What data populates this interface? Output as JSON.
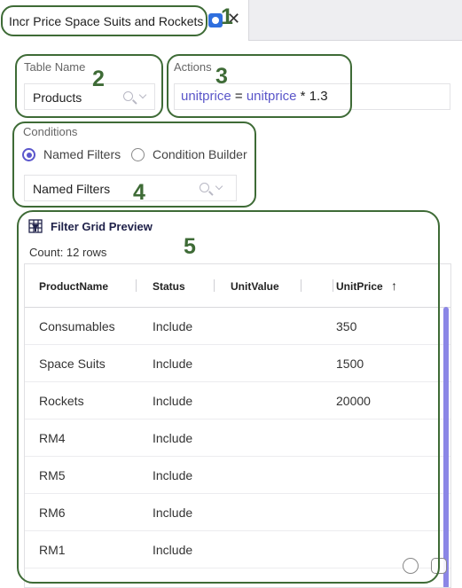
{
  "tab": {
    "title": "Incr Price Space Suits and Rockets",
    "close_glyph": "✕",
    "dirty_icon": "unsaved-indicator-icon"
  },
  "annotations": [
    "1",
    "2",
    "3",
    "4",
    "5"
  ],
  "table_name": {
    "label": "Table Name",
    "value": "Products"
  },
  "actions": {
    "label": "Actions",
    "expression": [
      {
        "text": "unitprice",
        "kind": "field"
      },
      {
        "text": " = ",
        "kind": "op"
      },
      {
        "text": "unitprice",
        "kind": "field"
      },
      {
        "text": " * 1.3",
        "kind": "op"
      }
    ]
  },
  "conditions": {
    "label": "Conditions",
    "options": [
      {
        "label": "Named Filters",
        "selected": true
      },
      {
        "label": "Condition Builder",
        "selected": false
      }
    ],
    "named_filter_placeholder": "Named Filters"
  },
  "preview": {
    "title": "Filter Grid Preview",
    "count_text": "Count: 12 rows",
    "columns": [
      "ProductName",
      "Status",
      "UnitValue",
      "UnitPrice"
    ],
    "sort_indicator": "↑",
    "rows": [
      [
        "Consumables",
        "Include",
        "",
        "350"
      ],
      [
        "Space Suits",
        "Include",
        "",
        "1500"
      ],
      [
        "Rockets",
        "Include",
        "",
        "20000"
      ],
      [
        "RM4",
        "Include",
        "",
        ""
      ],
      [
        "RM5",
        "Include",
        "",
        ""
      ],
      [
        "RM6",
        "Include",
        "",
        ""
      ],
      [
        "RM1",
        "Include",
        "",
        ""
      ]
    ]
  },
  "colors": {
    "accent": "#5b57cc",
    "field_token": "#5a56c9",
    "callout": "#3e6b36",
    "scrollbar": "#8b86e6"
  }
}
